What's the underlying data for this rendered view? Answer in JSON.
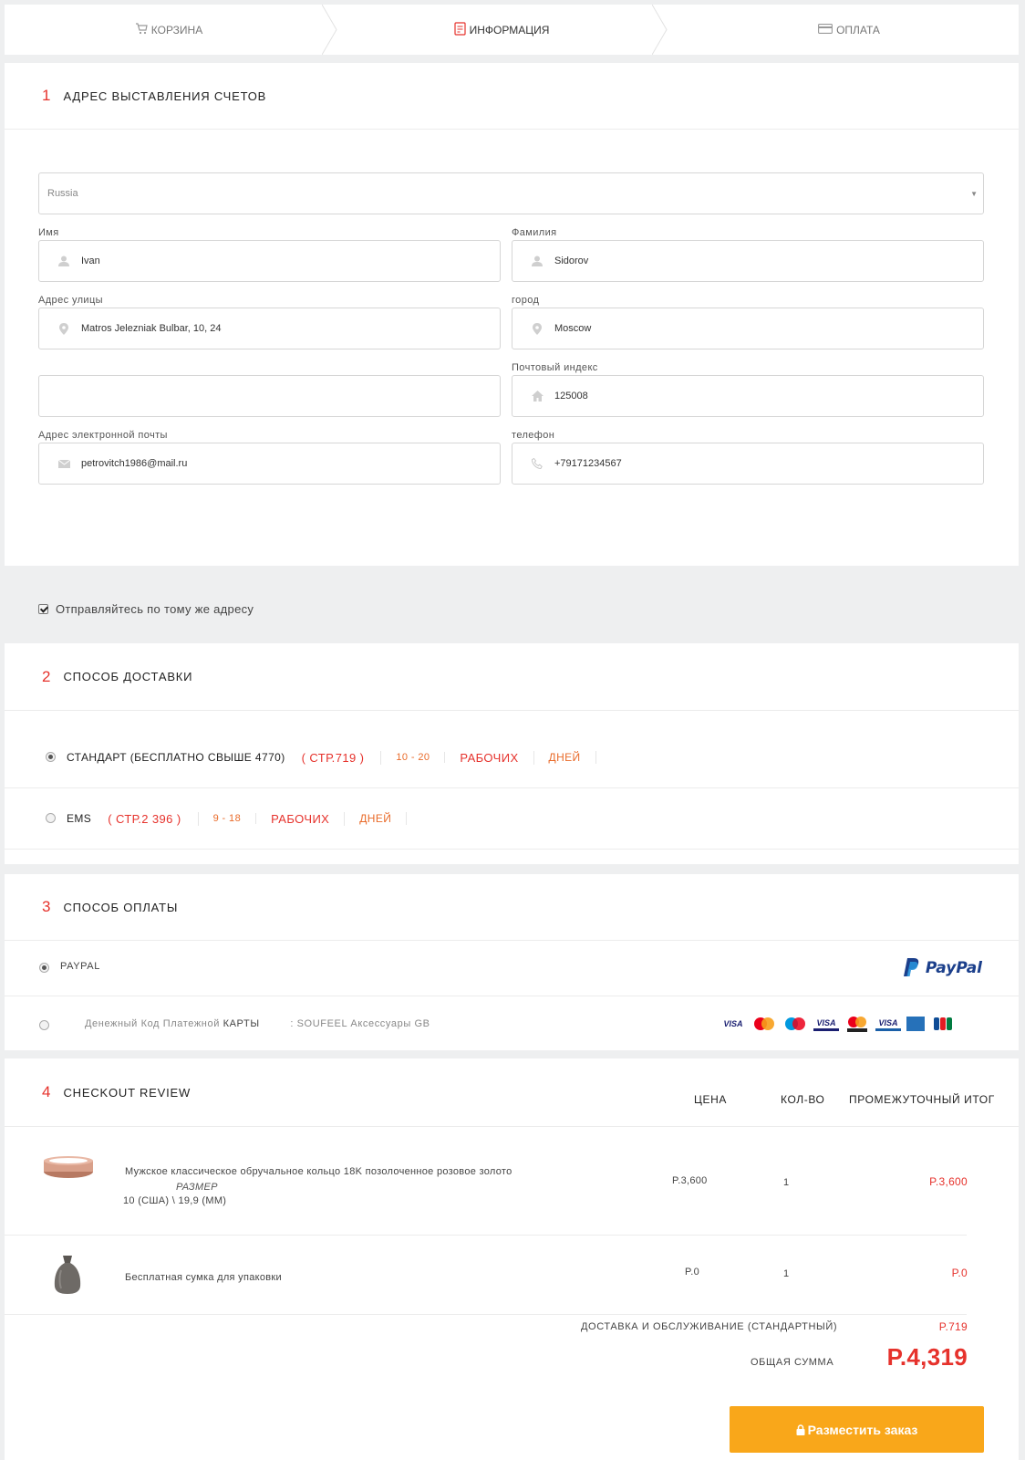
{
  "steps": [
    {
      "label": "КОРЗИНА",
      "icon": "cart-icon"
    },
    {
      "label": "ИНФОРМАЦИЯ",
      "icon": "document-icon"
    },
    {
      "label": "ОПЛАТА",
      "icon": "credit-card-icon"
    }
  ],
  "billing": {
    "num": "1",
    "title": "АДРЕС ВЫСТАВЛЕНИЯ СЧЕТОВ",
    "country": "Russia",
    "first_name_label": "Имя",
    "first_name": "Ivan",
    "last_name_label": "Фамилия",
    "last_name": "Sidorov",
    "street_label": "Адрес улицы",
    "street": "Matros Jelezniak Bulbar, 10, 24",
    "city_label": "город",
    "city": "Moscow",
    "street2": "",
    "zip_label": "Почтовый индекс",
    "zip": "125008",
    "email_label": "Адрес электронной почты",
    "email": "petrovitch1986@mail.ru",
    "phone_label": "телефон",
    "phone": "+79171234567"
  },
  "same_address_label": "Отправляйтесь по тому же адресу",
  "shipping": {
    "num": "2",
    "title": "СПОСОБ ДОСТАВКИ",
    "options": [
      {
        "name": "СТАНДАРТ (БЕСПЛАТНО СВЫШЕ 4770)",
        "price": "( СТР.719 )",
        "days": "10 - 20",
        "work": "РАБОЧИХ",
        "d": "ДНЕЙ",
        "selected": true
      },
      {
        "name": "EMS",
        "price": "( СТР.2 396 )",
        "days": "9 - 18",
        "work": "РАБОЧИХ",
        "d": "ДНЕЙ",
        "selected": false
      }
    ]
  },
  "payment": {
    "num": "3",
    "title": "СПОСОБ ОПЛАТЫ",
    "paypal_label": "PAYPAL",
    "paypal_logo": "PayPal",
    "card_label_a": "Денежный Код Платежной",
    "card_label_b": "КАРТЫ",
    "card_label_c": ": SOUFEEL Аксессуары GB",
    "card_brands": [
      "VISA",
      "mastercard",
      "maestro",
      "VISA Debit",
      "Debit",
      "VISA Electron",
      "AMEX",
      "JCB"
    ]
  },
  "review": {
    "num": "4",
    "title": "CHECKOUT REVIEW",
    "col_price": "ЦЕНА",
    "col_qty": "КОЛ-ВО",
    "col_subtotal": "ПРОМЕЖУТОЧНЫЙ ИТОГ",
    "items": [
      {
        "name": "Мужское классическое обручальное кольцо 18K позолоченное розовое золото",
        "size_label": "РАЗМЕР",
        "size": "10 (США) \\ 19,9 (ММ)",
        "price": "P.3,600",
        "qty": "1",
        "subtotal": "P.3,600"
      },
      {
        "name": "Бесплатная сумка для упаковки",
        "price": "P.0",
        "qty": "1",
        "subtotal": "P.0"
      }
    ],
    "shipping_label": "ДОСТАВКА И ОБСЛУЖИВАНИЕ (СТАНДАРТНЫЙ)",
    "shipping_value": "P.719",
    "total_label": "ОБЩАЯ СУММА",
    "total_value": "P.4,319"
  },
  "place_order": "Разместить заказ",
  "colors": {
    "accent": "#e6322c",
    "button": "#f9a71a",
    "orange_text": "#e96b2a"
  }
}
